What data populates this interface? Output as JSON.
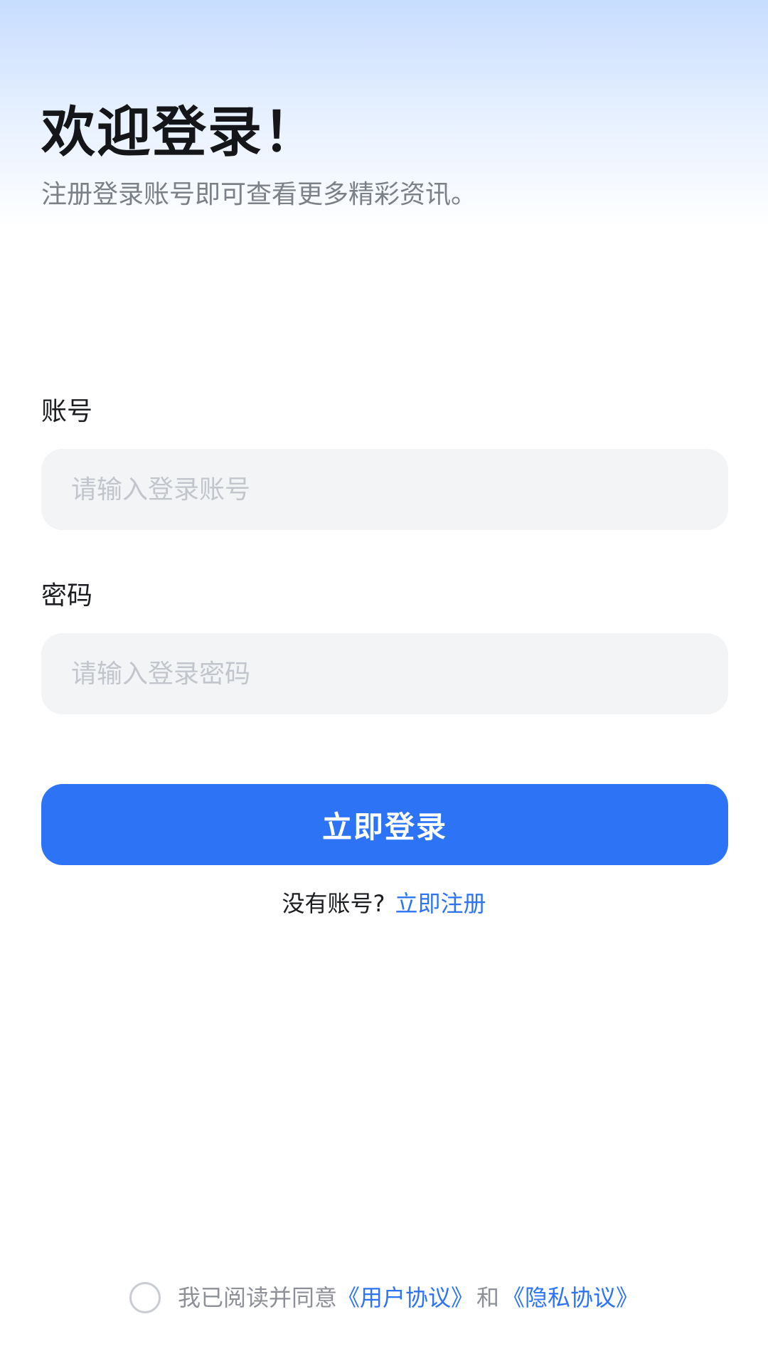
{
  "header": {
    "title": "欢迎登录！",
    "subtitle": "注册登录账号即可查看更多精彩资讯。"
  },
  "form": {
    "account_label": "账号",
    "account_placeholder": "请输入登录账号",
    "account_value": "",
    "password_label": "密码",
    "password_placeholder": "请输入登录密码",
    "password_value": "",
    "login_button": "立即登录"
  },
  "register": {
    "prompt": "没有账号?",
    "link": "立即注册"
  },
  "agreement": {
    "checked": false,
    "text": "我已阅读并同意",
    "user_agreement": "《用户协议》",
    "and": "和",
    "privacy_agreement": "《隐私协议》"
  },
  "colors": {
    "accent": "#2d73f5",
    "input_bg": "#f3f4f6",
    "header_gradient_top": "#c7ddff"
  }
}
